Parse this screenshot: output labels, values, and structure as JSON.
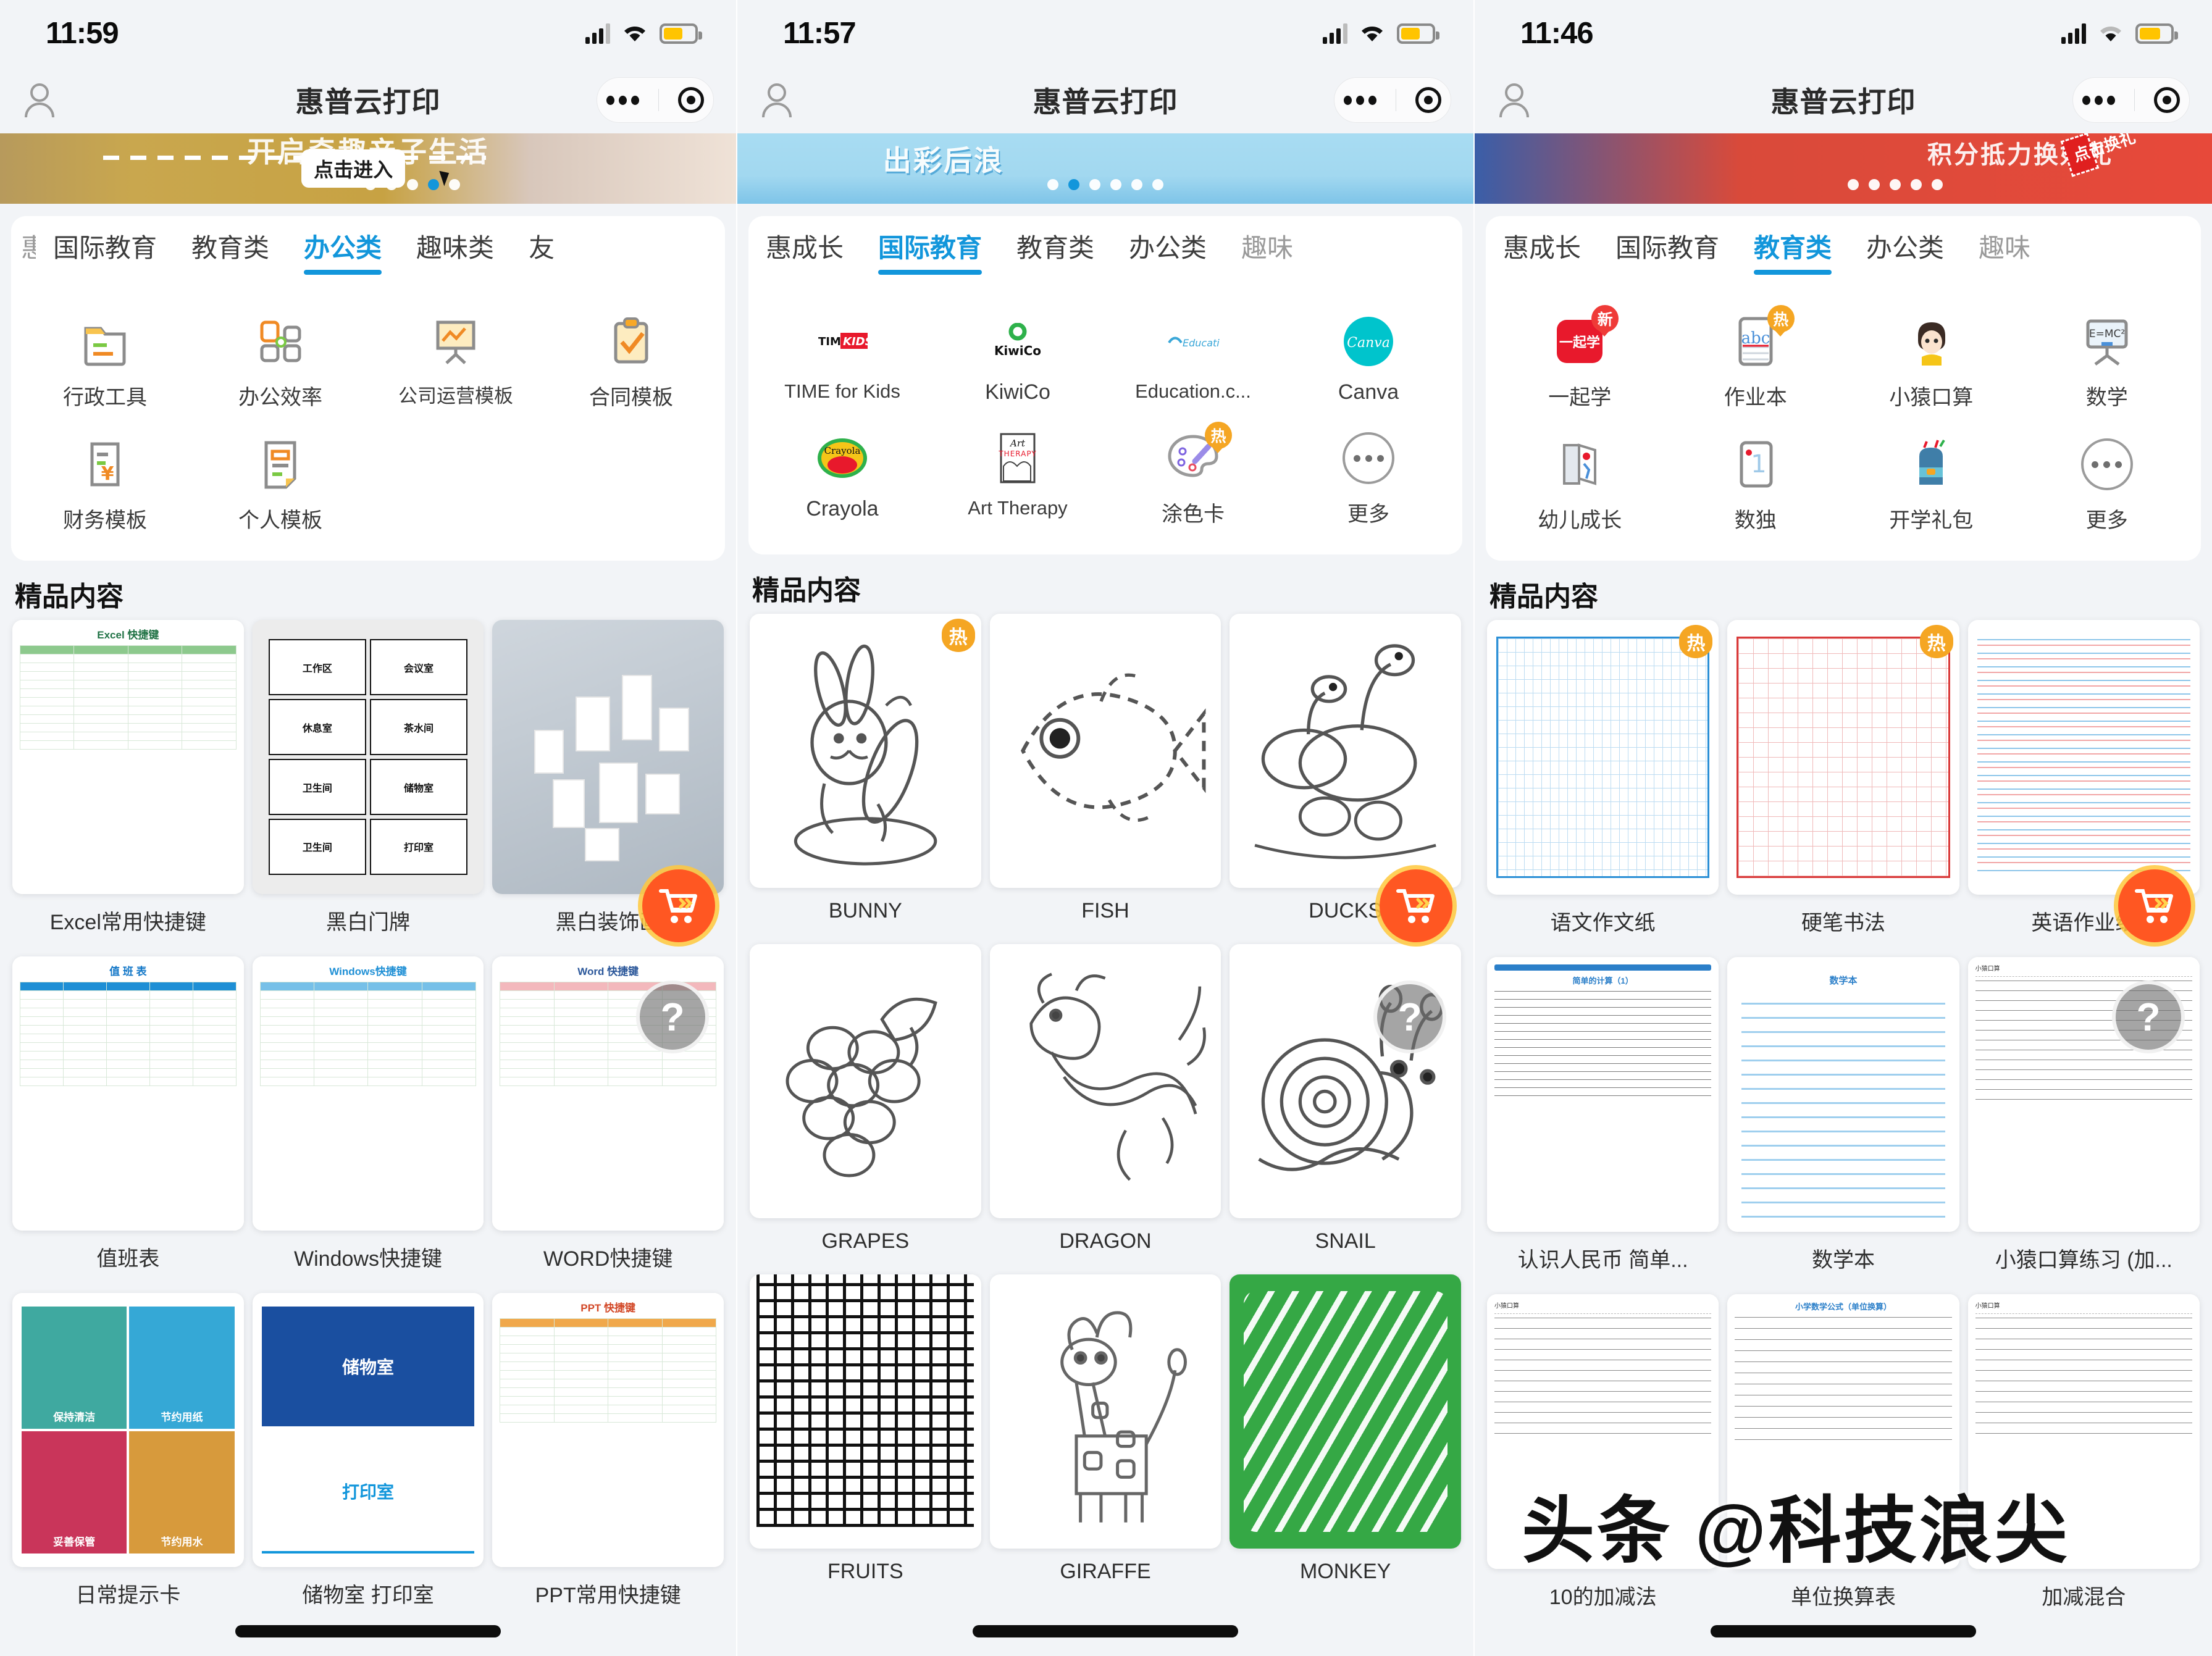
{
  "app": {
    "title": "惠普云打印"
  },
  "panels": [
    {
      "status": {
        "time": "11:59"
      },
      "banner": {
        "text": "开启奇趣亲子生活",
        "button": "点击进入",
        "dots": 5,
        "active": 3
      },
      "tabs": [
        {
          "label": "惠成长",
          "active": false,
          "clipped": true
        },
        {
          "label": "国际教育",
          "active": false
        },
        {
          "label": "教育类",
          "active": false
        },
        {
          "label": "办公类",
          "active": true
        },
        {
          "label": "趣味类",
          "active": false
        },
        {
          "label": "友",
          "active": false,
          "clipped": true
        }
      ],
      "categories": [
        {
          "label": "行政工具",
          "icon": "folder-icon",
          "badge": ""
        },
        {
          "label": "办公效率",
          "icon": "efficiency-icon",
          "badge": ""
        },
        {
          "label": "公司运营模板",
          "icon": "presentation-icon",
          "badge": ""
        },
        {
          "label": "合同模板",
          "icon": "clipboard-check-icon",
          "badge": ""
        },
        {
          "label": "财务模板",
          "icon": "finance-icon",
          "badge": ""
        },
        {
          "label": "个人模板",
          "icon": "document-icon",
          "badge": ""
        }
      ],
      "featured_title": "精品内容",
      "featured": [
        {
          "label": "Excel常用快捷键",
          "art": "excel-shortcut-sheet",
          "badge": ""
        },
        {
          "label": "黑白门牌",
          "art": "door-signs",
          "badge": ""
        },
        {
          "label": "黑白装饰画",
          "art": "photo-wall",
          "badge": ""
        },
        {
          "label": "值班表",
          "art": "duty-roster",
          "badge": ""
        },
        {
          "label": "Windows快捷键",
          "art": "windows-shortcut-sheet",
          "badge": ""
        },
        {
          "label": "WORD快捷键",
          "art": "word-shortcut-sheet",
          "badge": ""
        },
        {
          "label": "日常提示卡",
          "art": "tip-cards",
          "badge": ""
        },
        {
          "label": "储物室 打印室",
          "art": "room-signs",
          "badge": ""
        },
        {
          "label": "PPT常用快捷键",
          "art": "ppt-shortcut-sheet",
          "badge": ""
        }
      ]
    },
    {
      "status": {
        "time": "11:57"
      },
      "banner": {
        "text": "出彩后浪",
        "button": "",
        "dots": 6,
        "active": 1
      },
      "tabs": [
        {
          "label": "惠成长",
          "active": false
        },
        {
          "label": "国际教育",
          "active": true
        },
        {
          "label": "教育类",
          "active": false
        },
        {
          "label": "办公类",
          "active": false
        },
        {
          "label": "趣味",
          "active": false,
          "clipped": true
        }
      ],
      "categories": [
        {
          "label": "TIME for Kids",
          "icon": "time-for-kids-logo",
          "badge": ""
        },
        {
          "label": "KiwiCo",
          "icon": "kiwico-logo",
          "badge": ""
        },
        {
          "label": "Education.c...",
          "icon": "education-com-logo",
          "badge": ""
        },
        {
          "label": "Canva",
          "icon": "canva-logo",
          "badge": ""
        },
        {
          "label": "Crayola",
          "icon": "crayola-logo",
          "badge": ""
        },
        {
          "label": "Art Therapy",
          "icon": "art-therapy-logo",
          "badge": ""
        },
        {
          "label": "涂色卡",
          "icon": "palette-icon",
          "badge": "热"
        },
        {
          "label": "更多",
          "icon": "more-icon",
          "badge": ""
        }
      ],
      "featured_title": "精品内容",
      "featured": [
        {
          "label": "BUNNY",
          "art": "bunny-coloring",
          "badge": "热"
        },
        {
          "label": "FISH",
          "art": "fish-coloring",
          "badge": ""
        },
        {
          "label": "DUCKS",
          "art": "ducks-coloring",
          "badge": ""
        },
        {
          "label": "GRAPES",
          "art": "grapes-coloring",
          "badge": ""
        },
        {
          "label": "DRAGON",
          "art": "dragon-coloring",
          "badge": ""
        },
        {
          "label": "SNAIL",
          "art": "snail-coloring",
          "badge": ""
        },
        {
          "label": "FRUITS",
          "art": "fruits-maze",
          "badge": ""
        },
        {
          "label": "GIRAFFE",
          "art": "giraffe-coloring",
          "badge": ""
        },
        {
          "label": "MONKEY",
          "art": "monkey-maze",
          "badge": ""
        }
      ]
    },
    {
      "status": {
        "time": "11:46"
      },
      "banner": {
        "text": "积分抵力换好礼",
        "button": "点击换礼",
        "dots": 5,
        "active": -1
      },
      "tabs": [
        {
          "label": "惠成长",
          "active": false
        },
        {
          "label": "国际教育",
          "active": false
        },
        {
          "label": "教育类",
          "active": true
        },
        {
          "label": "办公类",
          "active": false
        },
        {
          "label": "趣味",
          "active": false,
          "clipped": true
        }
      ],
      "categories": [
        {
          "label": "一起学",
          "icon": "yiqixue-logo",
          "badge": "新"
        },
        {
          "label": "作业本",
          "icon": "homework-book-icon",
          "badge": "热"
        },
        {
          "label": "小猿口算",
          "icon": "xiaoyuan-monkey-icon",
          "badge": ""
        },
        {
          "label": "数学",
          "icon": "whiteboard-emc2-icon",
          "badge": ""
        },
        {
          "label": "幼儿成长",
          "icon": "growth-book-icon",
          "badge": ""
        },
        {
          "label": "数独",
          "icon": "sudoku-icon",
          "badge": ""
        },
        {
          "label": "开学礼包",
          "icon": "backpack-icon",
          "badge": ""
        },
        {
          "label": "更多",
          "icon": "more-icon",
          "badge": ""
        }
      ],
      "featured_title": "精品内容",
      "featured": [
        {
          "label": "语文作文纸",
          "art": "chinese-composition-paper",
          "badge": "热"
        },
        {
          "label": "硬笔书法",
          "art": "calligraphy-paper",
          "badge": "热"
        },
        {
          "label": "英语作业纸",
          "art": "english-paper",
          "badge": ""
        },
        {
          "label": "认识人民币 简单...",
          "art": "rmb-worksheet",
          "badge": ""
        },
        {
          "label": "数学本",
          "art": "math-notebook",
          "badge": ""
        },
        {
          "label": "小猿口算练习 (加...",
          "art": "xiaoyuan-practice",
          "badge": ""
        },
        {
          "label": "10的加减法",
          "art": "addition-ten",
          "badge": ""
        },
        {
          "label": "单位换算表",
          "art": "unit-conversion",
          "badge": ""
        },
        {
          "label": "加减混合",
          "art": "mixed-operations",
          "badge": ""
        }
      ]
    }
  ],
  "overlay": {
    "cart_icon": "shopping-cart-icon",
    "help_label": "?",
    "watermark": "头条 @科技浪尖"
  },
  "colors": {
    "accent": "#1296db",
    "hot": "#f5a623",
    "new": "#ef3b38",
    "cart": "#ff5722",
    "battery": "#ffc400"
  }
}
